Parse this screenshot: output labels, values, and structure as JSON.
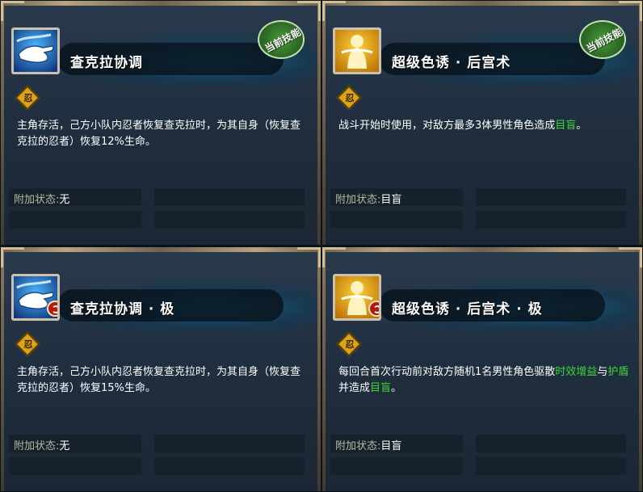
{
  "panels": [
    {
      "skill_name": "查克拉协调",
      "icon": "chakra-hand-icon",
      "icon_theme": "blue",
      "rank_mark": false,
      "current_badge": "当前技能",
      "nin_mark": "忍",
      "description": "主角存活，己方小队内忍者恢复查克拉时，为其自身（恢复查克拉的忍者）恢复12%生命。",
      "status_label": "附加状态:",
      "status_value": "无"
    },
    {
      "skill_name": "超级色诱 · 后宫术",
      "icon": "harem-jutsu-icon",
      "icon_theme": "gold",
      "rank_mark": false,
      "current_badge": "当前技能",
      "nin_mark": "忍",
      "description_parts": [
        "战斗开始时使用，对敌方最多3体男性角色造成",
        "目盲",
        "。"
      ],
      "status_label": "附加状态:",
      "status_value": "目盲"
    },
    {
      "skill_name": "查克拉协调 · 极",
      "icon": "chakra-hand-icon",
      "icon_theme": "blue",
      "rank_mark": true,
      "current_badge": "",
      "nin_mark": "忍",
      "description": "主角存活，己方小队内忍者恢复查克拉时，为其自身（恢复查克拉的忍者）恢复15%生命。",
      "status_label": "附加状态:",
      "status_value": "无"
    },
    {
      "skill_name": "超级色诱 · 后宫术 · 极",
      "icon": "harem-jutsu-icon",
      "icon_theme": "gold",
      "rank_mark": true,
      "current_badge": "",
      "nin_mark": "忍",
      "description_parts": [
        "每回合首次行动前对敌方随机1名男性角色驱散",
        "时效增益",
        "与",
        "护盾",
        "并造成",
        "目盲",
        "。"
      ],
      "status_label": "附加状态:",
      "status_value": "目盲"
    }
  ],
  "colors": {
    "highlight_green": "#3ad83a",
    "panel_bg": "#1f2d3d",
    "badge_green": "#2f6b28"
  }
}
